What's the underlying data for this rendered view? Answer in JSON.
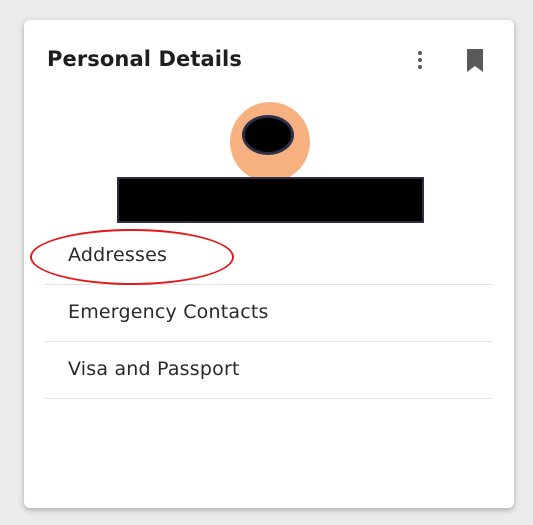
{
  "card": {
    "title": "Personal Details",
    "actions": [
      {
        "icon": "more-vert-icon"
      },
      {
        "icon": "bookmark-icon"
      }
    ],
    "profile": {
      "avatar_color": "#f7b180",
      "redaction_color": "#000000"
    },
    "menu_items": [
      {
        "label": "Addresses"
      },
      {
        "label": "Emergency Contacts"
      },
      {
        "label": "Visa and Passport"
      }
    ]
  },
  "annotation": {
    "highlight_color": "#e5191c",
    "highlighted_item": "Addresses"
  }
}
